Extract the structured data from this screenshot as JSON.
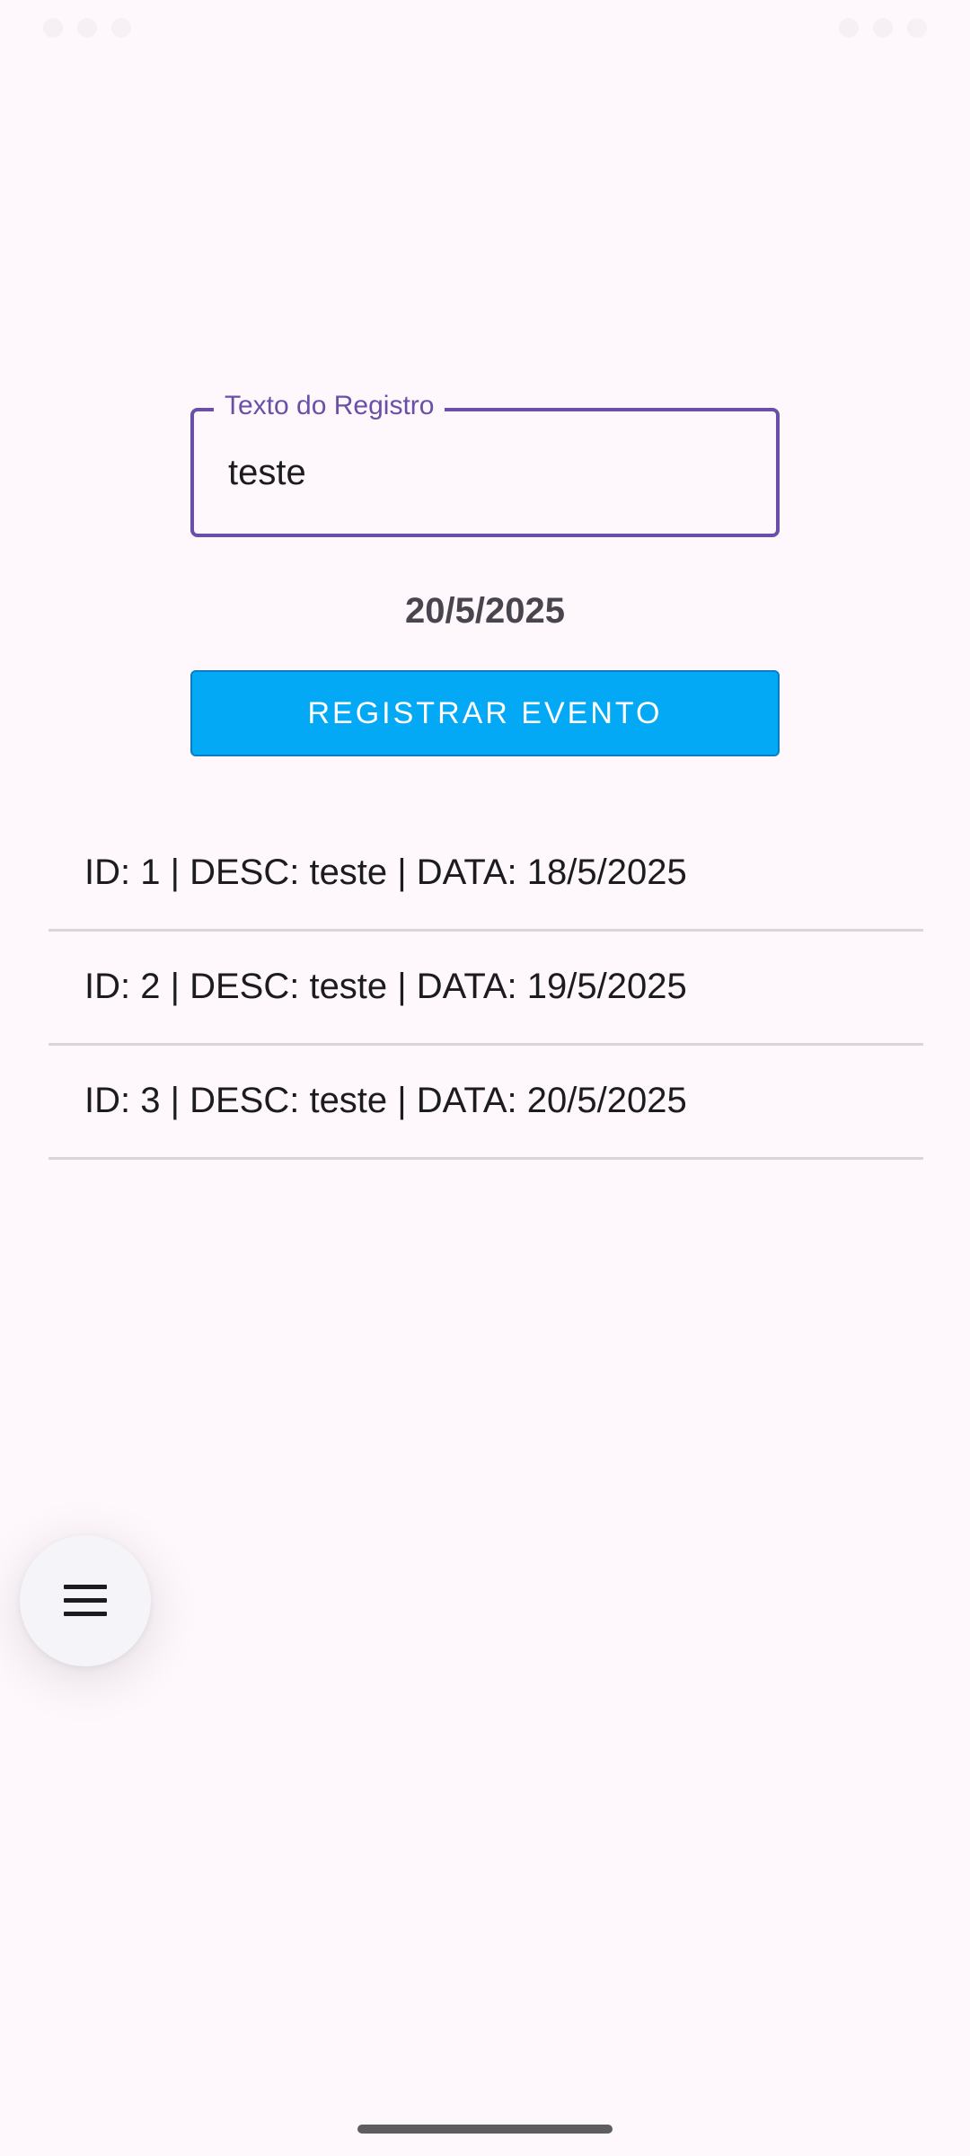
{
  "form": {
    "field_label": "Texto do Registro",
    "field_value": "teste",
    "date": "20/5/2025",
    "register_button_label": "REGISTRAR EVENTO"
  },
  "events": [
    "ID: 1 | DESC: teste | DATA: 18/5/2025",
    "ID: 2 | DESC: teste | DATA: 19/5/2025",
    "ID: 3 | DESC: teste | DATA: 20/5/2025"
  ],
  "fab": {
    "icon": "menu-icon"
  },
  "colors": {
    "accent": "#6a4fa8",
    "button": "#03a9f4",
    "background": "#fef7fb"
  }
}
